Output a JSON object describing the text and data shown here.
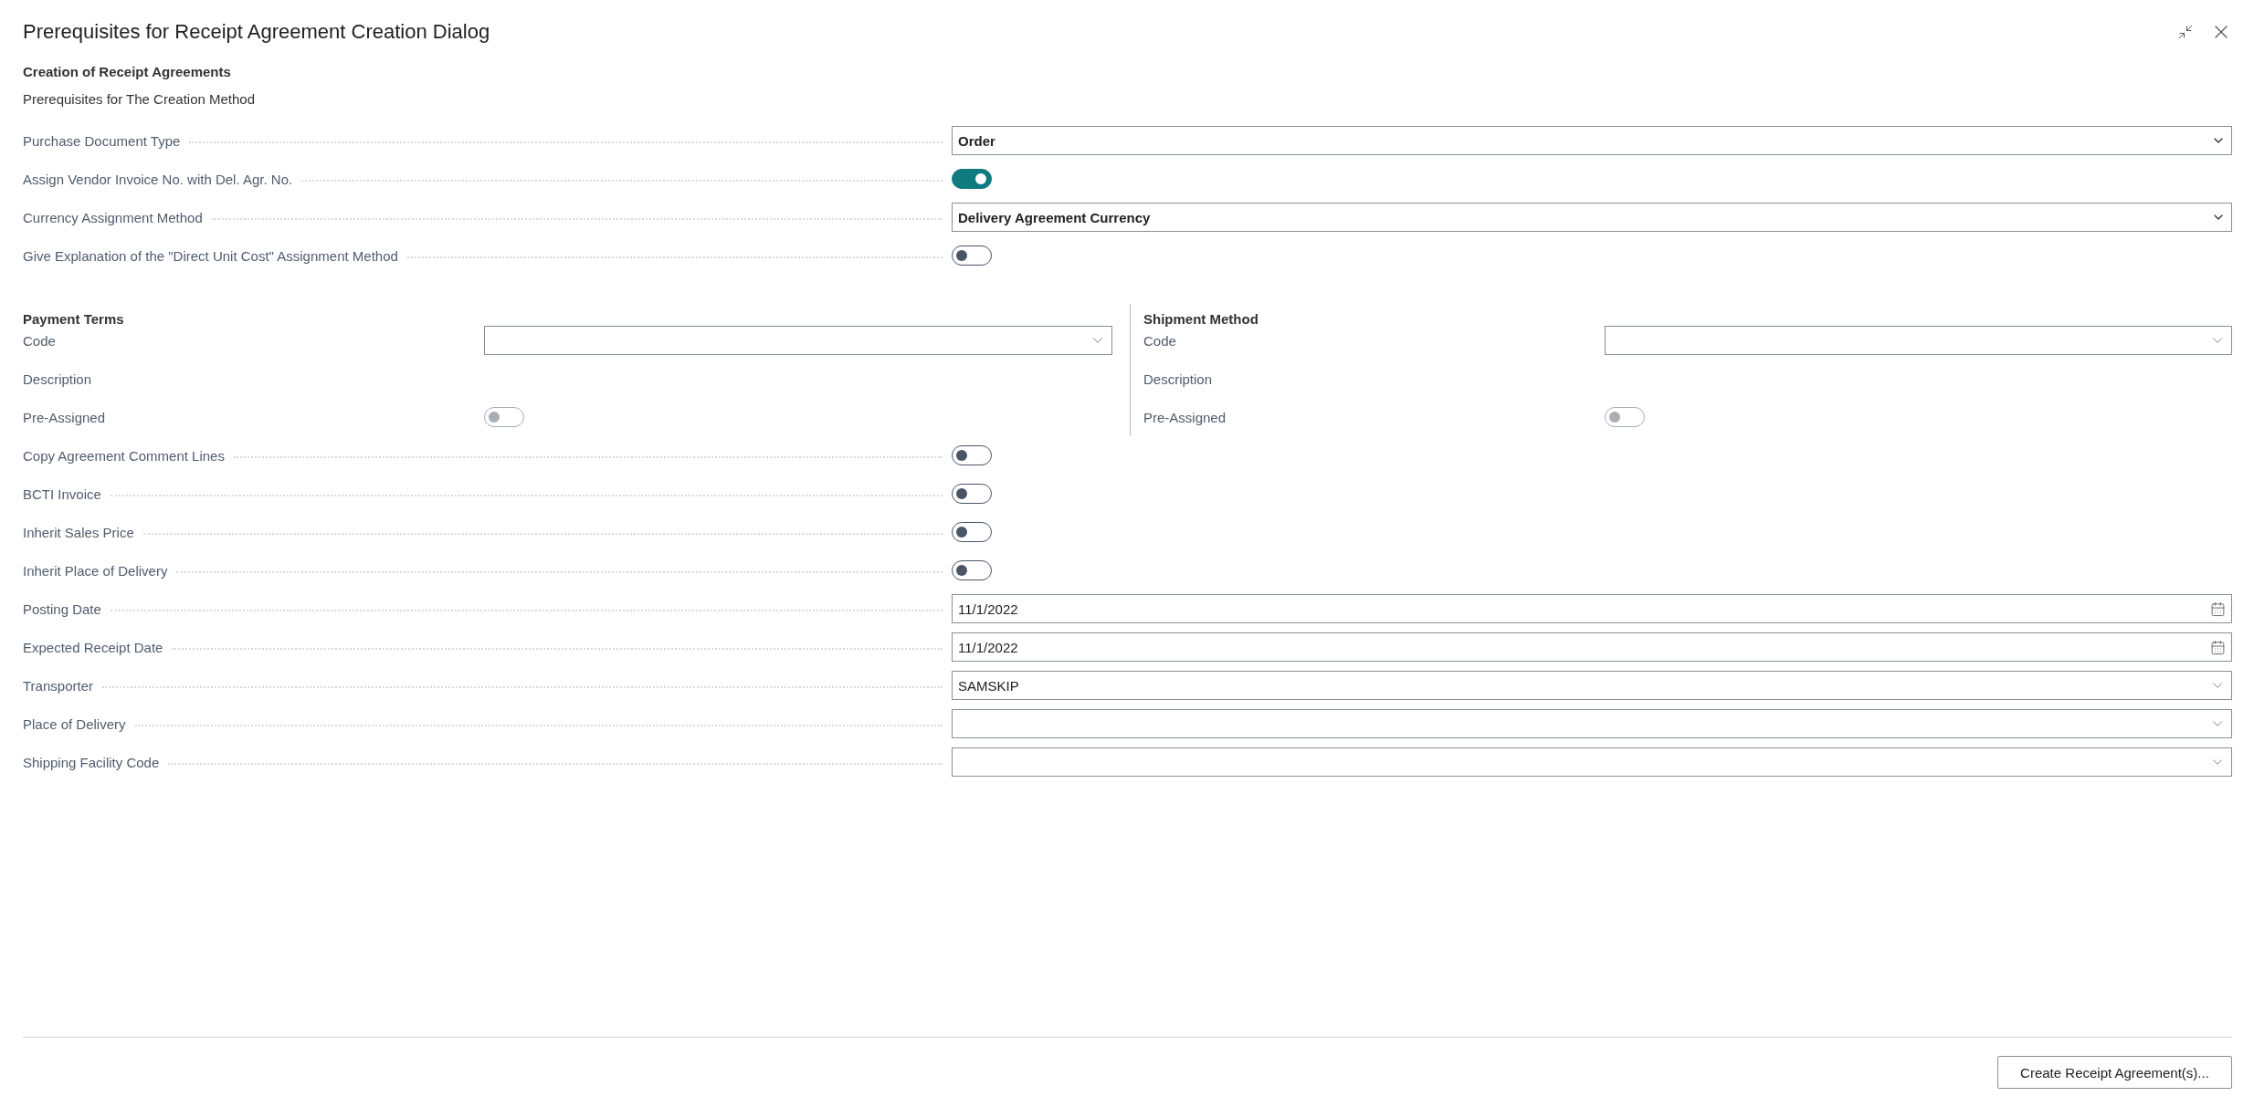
{
  "dialog": {
    "title": "Prerequisites for Receipt Agreement Creation Dialog"
  },
  "section": {
    "title": "Creation of Receipt Agreements",
    "subtitle": "Prerequisites for The Creation Method"
  },
  "fields": [
    {
      "kind": "option",
      "label": "Purchase Document Type",
      "value": "Order"
    },
    {
      "kind": "toggle",
      "label": "Assign Vendor Invoice No. with Del. Agr. No.",
      "on": true,
      "disabled": false
    },
    {
      "kind": "option",
      "label": "Currency Assignment Method",
      "value": "Delivery Agreement Currency"
    },
    {
      "kind": "toggle",
      "label": "Give Explanation of the \"Direct Unit Cost\" Assignment Method",
      "on": false,
      "disabled": false
    }
  ],
  "groups": [
    {
      "title": "Payment Terms",
      "fields": [
        {
          "kind": "lookup",
          "label": "Code"
        },
        {
          "kind": "text",
          "label": "Description"
        },
        {
          "kind": "toggle",
          "label": "Pre-Assigned",
          "on": false,
          "disabled": true
        }
      ]
    },
    {
      "title": "Shipment Method",
      "fields": [
        {
          "kind": "lookup",
          "label": "Code"
        },
        {
          "kind": "text",
          "label": "Description"
        },
        {
          "kind": "toggle",
          "label": "Pre-Assigned",
          "on": false,
          "disabled": true
        }
      ]
    }
  ],
  "more_fields": [
    {
      "kind": "toggle",
      "label": "Copy Agreement Comment Lines",
      "on": false,
      "disabled": false
    },
    {
      "kind": "toggle",
      "label": "BCTI Invoice",
      "on": false,
      "disabled": false
    },
    {
      "kind": "toggle",
      "label": "Inherit Sales Price",
      "on": false,
      "disabled": false
    },
    {
      "kind": "toggle",
      "label": "Inherit Place of Delivery",
      "on": false,
      "disabled": false
    },
    {
      "kind": "date",
      "label": "Posting Date",
      "value": "11/1/2022"
    },
    {
      "kind": "date",
      "label": "Expected Receipt Date",
      "value": "11/1/2022"
    },
    {
      "kind": "lookup",
      "label": "Transporter",
      "value": "SAMSKIP"
    },
    {
      "kind": "lookup",
      "label": "Place of Delivery"
    },
    {
      "kind": "lookup",
      "label": "Shipping Facility Code"
    }
  ],
  "button": "Create Receipt Agreement(s)..."
}
